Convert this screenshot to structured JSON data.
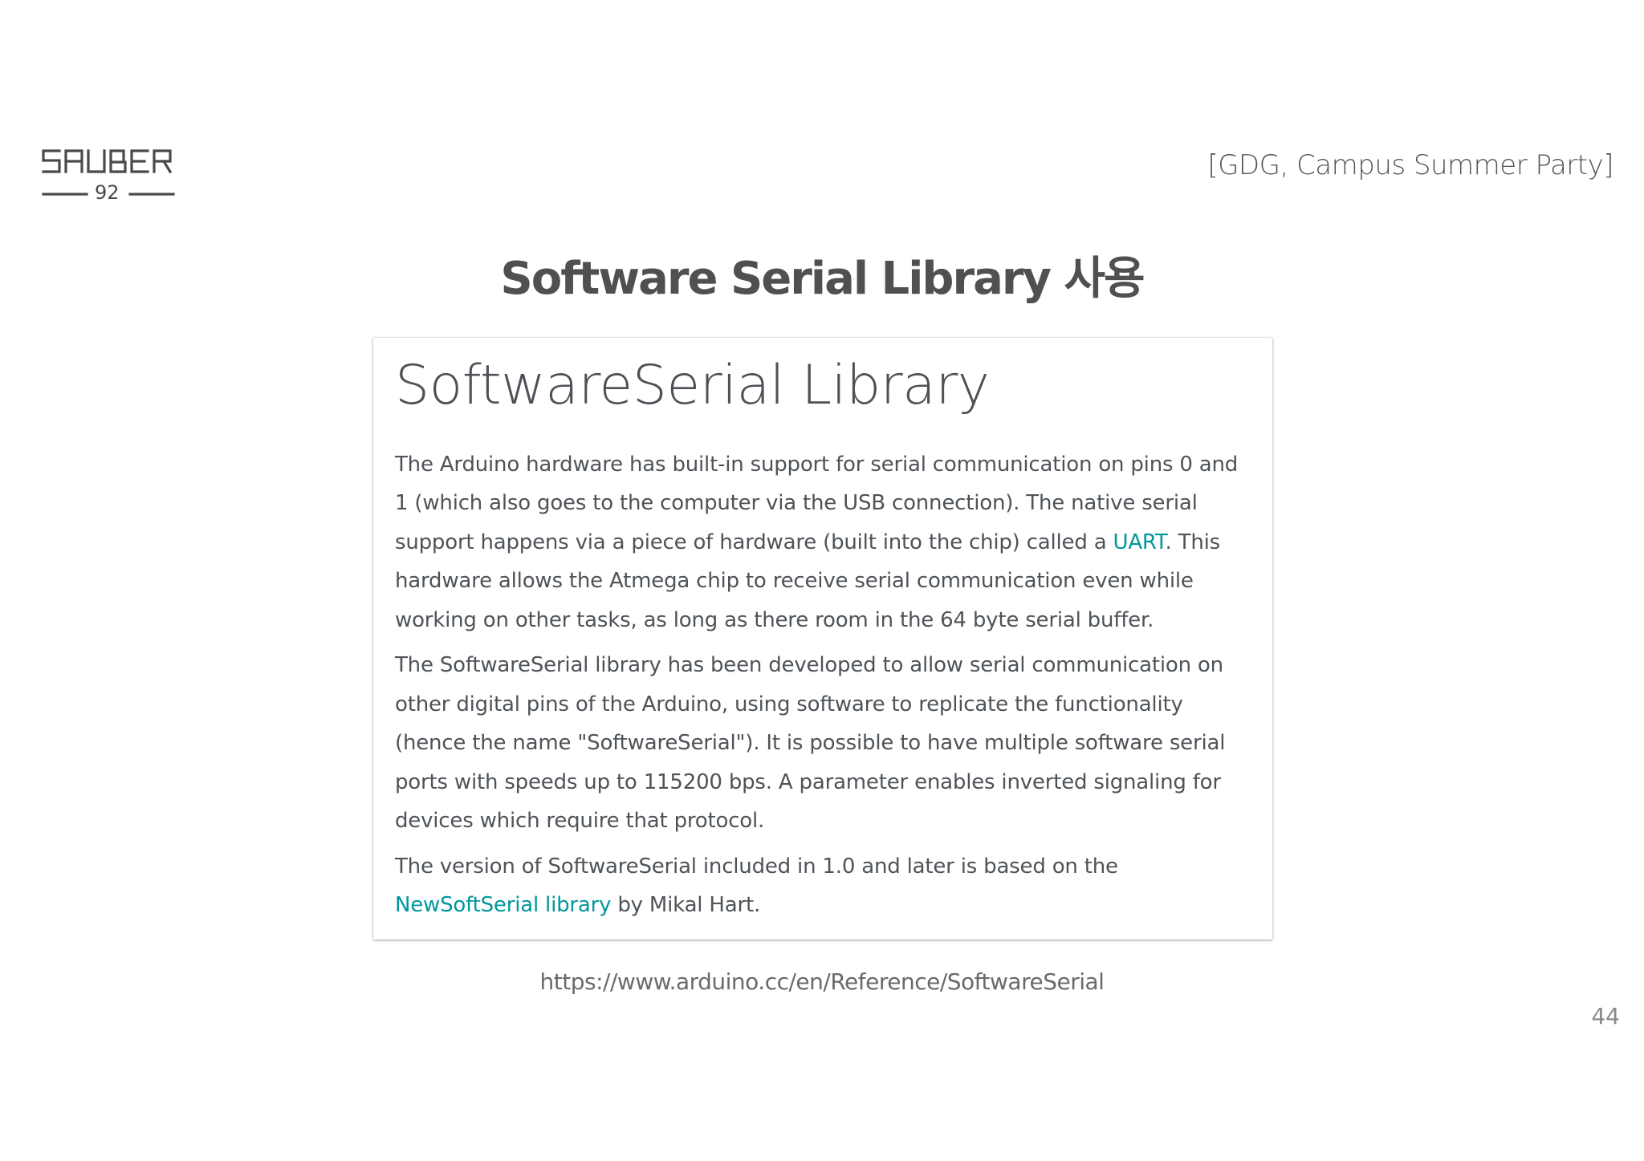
{
  "header": {
    "logo_text": "SAUBER",
    "logo_number": "92",
    "event_tag": "[GDG, Campus Summer Party]"
  },
  "slide": {
    "title": "Software Serial Library 사용",
    "page_number": "44"
  },
  "card": {
    "heading": "SoftwareSerial Library",
    "para1_part1": "The Arduino hardware has built-in support for serial communication on pins 0 and 1 (which also goes to the computer via the USB connection). The native serial support happens via a piece of hardware (built into the chip) called a ",
    "para1_link": "UART",
    "para1_part2": ". This hardware allows the Atmega chip to receive serial communication even while working on other tasks, as long as there room in the 64 byte serial buffer.",
    "para2": "The SoftwareSerial library has been developed to allow serial communication on other digital pins of the Arduino, using software to replicate the functionality (hence the name \"SoftwareSerial\"). It is possible to have multiple software serial ports with speeds up to 115200 bps. A parameter enables inverted signaling for devices which require that protocol.",
    "para3_part1": "The version of SoftwareSerial included in 1.0 and later is based on the ",
    "para3_link": "NewSoftSerial library",
    "para3_part2": " by Mikal Hart."
  },
  "footer": {
    "source_url": "https://www.arduino.cc/en/Reference/SoftwareSerial"
  },
  "colors": {
    "link": "#00979c",
    "text": "#4e5358",
    "title": "#505050"
  }
}
